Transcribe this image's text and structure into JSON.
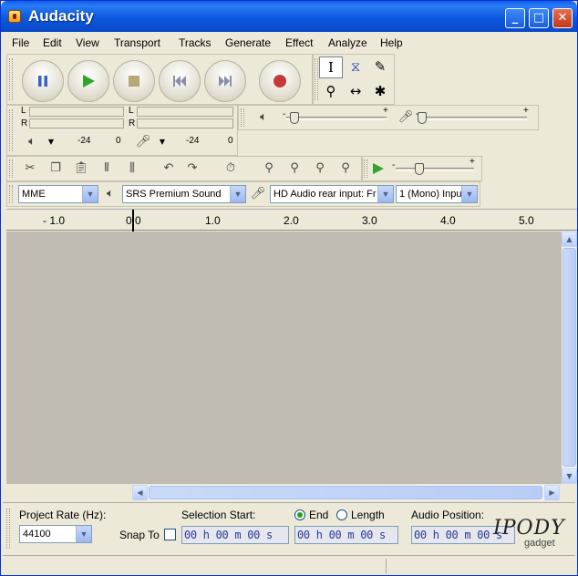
{
  "window": {
    "title": "Audacity"
  },
  "window_controls": {
    "minimize": "_",
    "maximize": "□",
    "close": "✕"
  },
  "menu": [
    "File",
    "Edit",
    "View",
    "Transport",
    "Tracks",
    "Generate",
    "Effect",
    "Analyze",
    "Help"
  ],
  "transport": {
    "buttons": [
      "pause",
      "play",
      "stop",
      "skip-start",
      "skip-end",
      "record"
    ]
  },
  "meters": {
    "left": "L",
    "right": "R",
    "playback_scale": [
      "-24",
      "0"
    ],
    "record_scale": [
      "-24",
      "0"
    ]
  },
  "mixer": {
    "plus": "+",
    "minus": "-"
  },
  "transcription": {
    "plus": "+",
    "minus": "-"
  },
  "device": {
    "host": "MME",
    "output": "SRS Premium Sound",
    "input": "HD Audio rear input: Fr",
    "channels": "1 (Mono) Inpu"
  },
  "ruler": {
    "labels": [
      "- 1.0",
      "0.0",
      "1.0",
      "2.0",
      "3.0",
      "4.0",
      "5.0"
    ]
  },
  "selection": {
    "project_rate_label": "Project Rate (Hz):",
    "project_rate_value": "44100",
    "snap_to_label": "Snap To",
    "selection_start_label": "Selection Start:",
    "end_label": "End",
    "length_label": "Length",
    "audio_position_label": "Audio Position:",
    "start_time": "00 h 00 m 00 s",
    "end_time": "00 h 00 m 00 s",
    "position_time": "00 h 00 m 00 s"
  },
  "watermark": {
    "brand": "IPODY",
    "sub": "gadget"
  },
  "colors": {
    "title_blue": "#0a5ee8",
    "play_green": "#2ea52e",
    "record_red": "#c43a3a",
    "track_bg": "#c0bcb2"
  }
}
